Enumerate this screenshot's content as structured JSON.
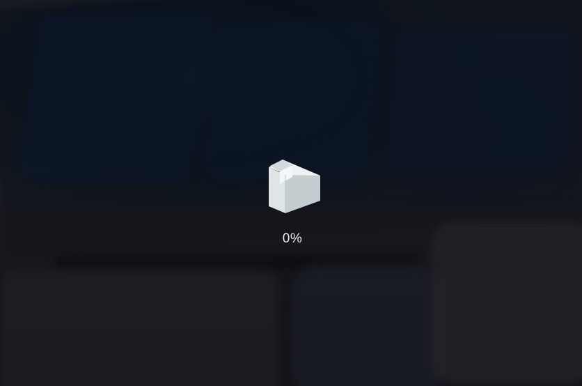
{
  "loading": {
    "progress_label": "0%",
    "progress": 0,
    "icon": "loading-cube-icon"
  },
  "colors": {
    "cube_top": "#eef2f3",
    "cube_left": "#dfe4e6",
    "cube_right": "#c3cbce",
    "text": "#e8ecef",
    "backdrop": "#1a1c20"
  }
}
